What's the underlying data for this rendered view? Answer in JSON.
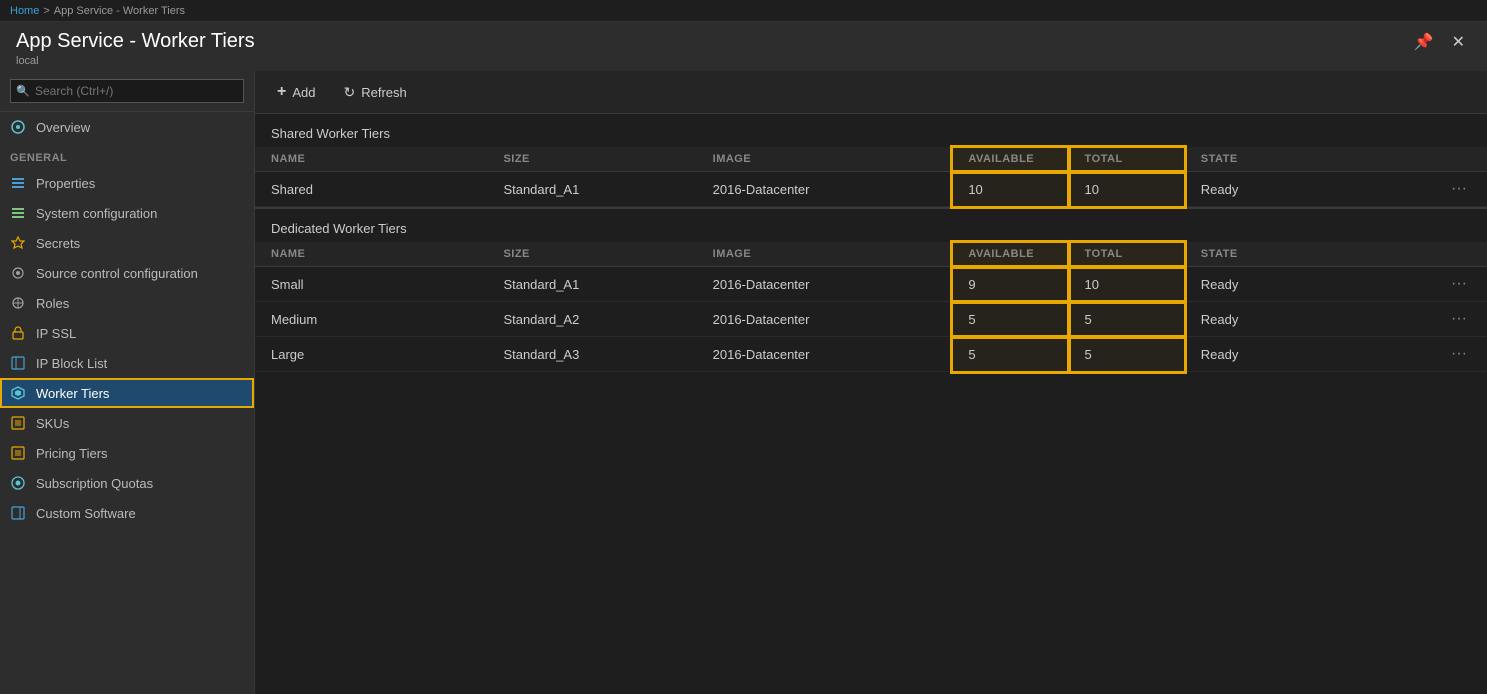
{
  "breadcrumb": {
    "home": "Home",
    "separator": ">",
    "current": "App Service - Worker Tiers"
  },
  "title": "App Service - Worker Tiers",
  "subtitle": "local",
  "toolbar": {
    "add_label": "Add",
    "refresh_label": "Refresh"
  },
  "sidebar": {
    "search_placeholder": "Search (Ctrl+/)",
    "general_label": "GENERAL",
    "items": [
      {
        "id": "overview",
        "label": "Overview",
        "icon": "○"
      },
      {
        "id": "properties",
        "label": "Properties",
        "icon": "≡"
      },
      {
        "id": "system-config",
        "label": "System configuration",
        "icon": "≡"
      },
      {
        "id": "secrets",
        "label": "Secrets",
        "icon": "💡"
      },
      {
        "id": "source-control",
        "label": "Source control configuration",
        "icon": "⚙"
      },
      {
        "id": "roles",
        "label": "Roles",
        "icon": "⚙"
      },
      {
        "id": "ip-ssl",
        "label": "IP SSL",
        "icon": "◧"
      },
      {
        "id": "ip-block",
        "label": "IP Block List",
        "icon": "◨"
      },
      {
        "id": "worker-tiers",
        "label": "Worker Tiers",
        "icon": "✦",
        "active": true
      },
      {
        "id": "skus",
        "label": "SKUs",
        "icon": "◧"
      },
      {
        "id": "pricing-tiers",
        "label": "Pricing Tiers",
        "icon": "◧"
      },
      {
        "id": "subscription-quotas",
        "label": "Subscription Quotas",
        "icon": "○"
      },
      {
        "id": "custom-software",
        "label": "Custom Software",
        "icon": "◨"
      }
    ]
  },
  "shared_section": {
    "title": "Shared Worker Tiers",
    "columns": {
      "name": "NAME",
      "size": "SIZE",
      "image": "IMAGE",
      "available": "AVAILABLE",
      "total": "TOTAL",
      "state": "STATE"
    },
    "rows": [
      {
        "name": "Shared",
        "size": "Standard_A1",
        "image": "2016-Datacenter",
        "available": "10",
        "total": "10",
        "state": "Ready"
      }
    ]
  },
  "dedicated_section": {
    "title": "Dedicated Worker Tiers",
    "columns": {
      "name": "NAME",
      "size": "SIZE",
      "image": "IMAGE",
      "available": "AVAILABLE",
      "total": "TOTAL",
      "state": "STATE"
    },
    "rows": [
      {
        "name": "Small",
        "size": "Standard_A1",
        "image": "2016-Datacenter",
        "available": "9",
        "total": "10",
        "state": "Ready"
      },
      {
        "name": "Medium",
        "size": "Standard_A2",
        "image": "2016-Datacenter",
        "available": "5",
        "total": "5",
        "state": "Ready"
      },
      {
        "name": "Large",
        "size": "Standard_A3",
        "image": "2016-Datacenter",
        "available": "5",
        "total": "5",
        "state": "Ready"
      }
    ]
  }
}
